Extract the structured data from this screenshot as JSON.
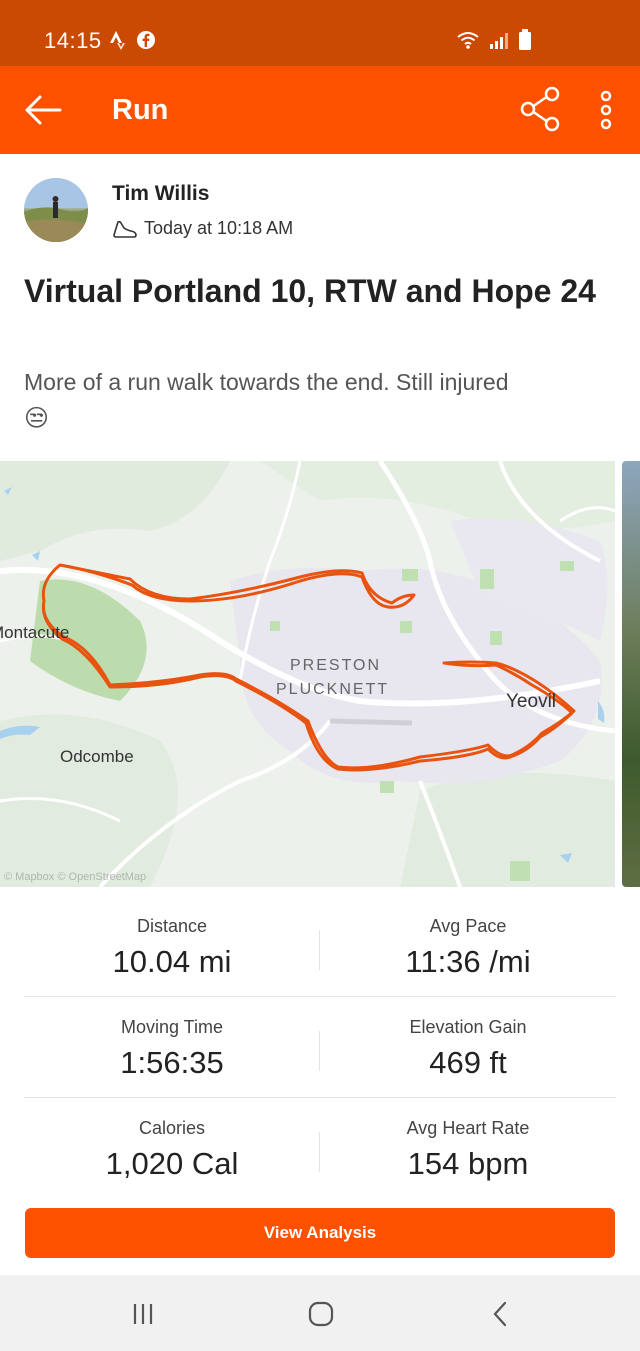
{
  "status_bar": {
    "time": "14:15",
    "left_icons": [
      "strava-icon",
      "facebook-icon"
    ],
    "right_icons": [
      "wifi-icon",
      "signal-icon",
      "battery-icon"
    ]
  },
  "app_bar": {
    "title": "Run",
    "icons": [
      "back-arrow-icon",
      "share-icon",
      "more-vertical-icon"
    ]
  },
  "athlete": {
    "name": "Tim Willis",
    "timestamp": "Today at 10:18 AM",
    "shoe_icon": "shoe-icon"
  },
  "activity": {
    "title": "Virtual Portland 10, RTW and Hope 24",
    "description": "More of a run walk towards the end. Still injured",
    "emoji": "😒"
  },
  "map": {
    "labels": {
      "montacute": "Montacute",
      "preston": "PRESTON",
      "plucknett": "PLUCKNETT",
      "yeovil": "Yeovil",
      "odcombe": "Odcombe"
    },
    "attribution": "© Mapbox © OpenStreetMap",
    "route_color": "#e8540f"
  },
  "stats": {
    "distance_label": "Distance",
    "distance_value": "10.04 mi",
    "pace_label": "Avg Pace",
    "pace_value": "11:36 /mi",
    "moving_time_label": "Moving Time",
    "moving_time_value": "1:56:35",
    "elevation_label": "Elevation Gain",
    "elevation_value": "469 ft",
    "calories_label": "Calories",
    "calories_value": "1,020 Cal",
    "heart_rate_label": "Avg Heart Rate",
    "heart_rate_value": "154 bpm"
  },
  "actions": {
    "view_analysis": "View Analysis"
  },
  "nav_bar": {
    "icons": [
      "recent-apps-icon",
      "home-icon",
      "back-icon"
    ]
  },
  "colors": {
    "brand": "#fc5200",
    "status_bar": "#c94a00"
  }
}
